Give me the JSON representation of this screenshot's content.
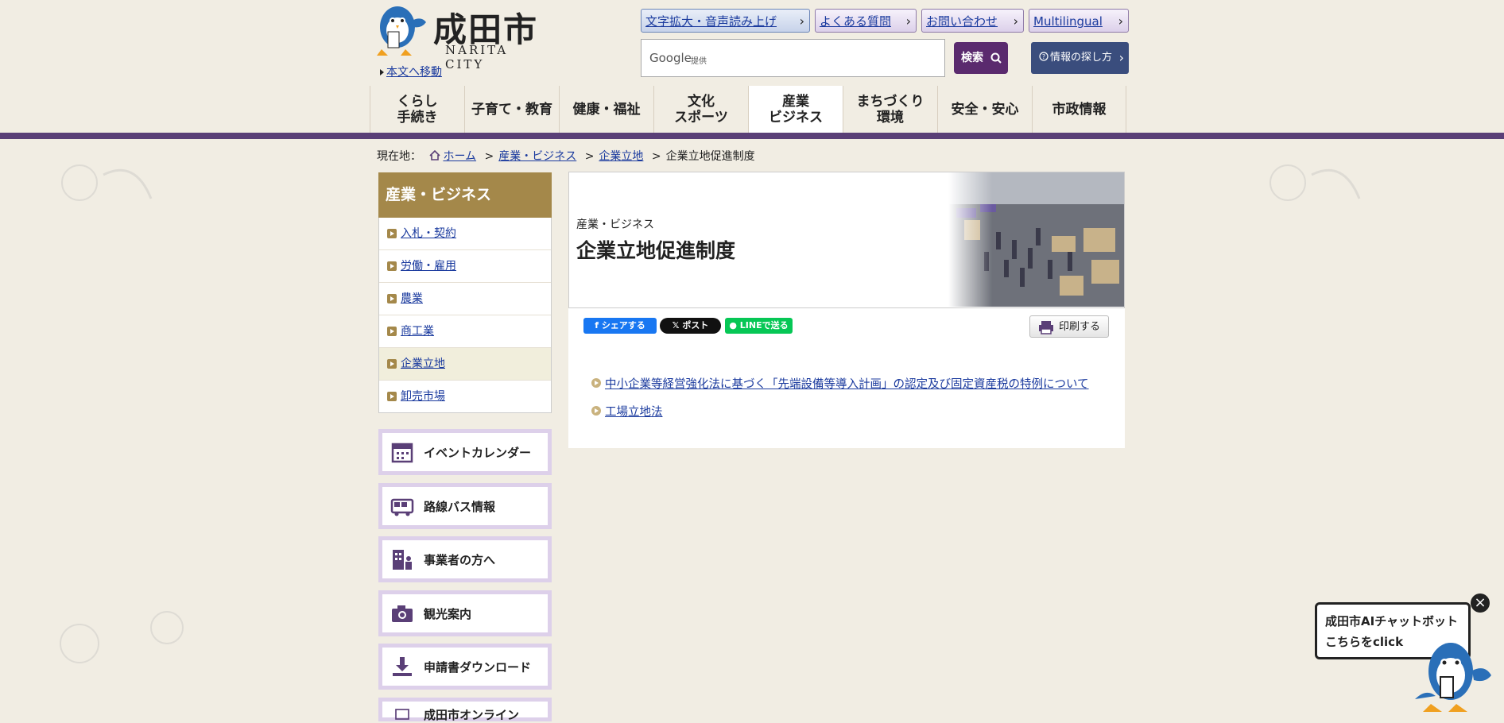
{
  "header": {
    "logo_title": "成田市",
    "logo_subtitle": "NARITA CITY",
    "skip_link": "本文へ移動",
    "top_buttons": [
      "文字拡大・音声読み上げ",
      "よくある質問",
      "お問い合わせ",
      "Multilingual"
    ],
    "search": {
      "google": "Google",
      "provided": "提供",
      "button": "検索"
    },
    "how_to_find": "情報の探し方"
  },
  "global_nav": [
    "くらし\n手続き",
    "子育て・教育",
    "健康・福祉",
    "文化\nスポーツ",
    "産業\nビジネス",
    "まちづくり\n環境",
    "安全・安心",
    "市政情報"
  ],
  "breadcrumb": {
    "label": "現在地：",
    "items": [
      "ホーム",
      "産業・ビジネス",
      "企業立地"
    ],
    "current": "企業立地促進制度"
  },
  "sidebar": {
    "heading": "産業・ビジネス",
    "items": [
      "入札・契約",
      "労働・雇用",
      "農業",
      "商工業",
      "企業立地",
      "卸売市場"
    ],
    "banners": [
      "イベントカレンダー",
      "路線バス情報",
      "事業者の方へ",
      "観光案内",
      "申請書ダウンロード",
      "成田市オンライン"
    ]
  },
  "main": {
    "category": "産業・ビジネス",
    "title": "企業立地促進制度",
    "share": {
      "facebook": "シェアする",
      "x": "ポスト",
      "line": "LINEで送る"
    },
    "print": "印刷する",
    "links": [
      "中小企業等経営強化法に基づく「先端設備等導入計画」の認定及び固定資産税の特例について",
      "工場立地法"
    ]
  },
  "chatbot": {
    "line1": "成田市AIチャットボット",
    "line2": "こちらをclick"
  },
  "colors": {
    "background": "#f1ede3",
    "purple": "#5a3f77",
    "gold": "#a4884a",
    "link": "#1a3a9e"
  }
}
